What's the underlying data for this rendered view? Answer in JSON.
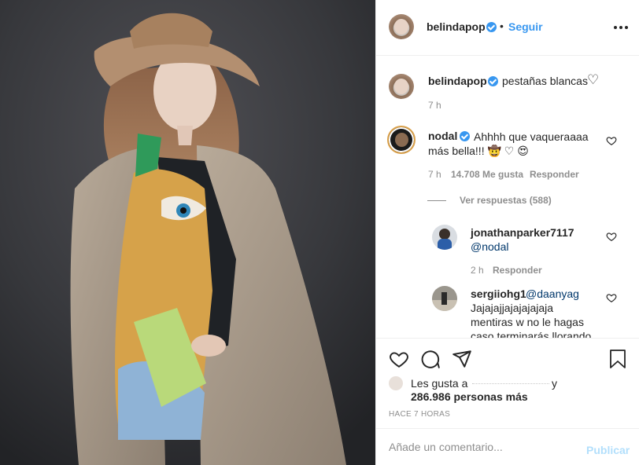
{
  "post": {
    "username": "belindapop",
    "follow_label": "Seguir",
    "dot": "•",
    "caption": "pestañas blancas",
    "caption_heart": "♡",
    "caption_time": "7 h"
  },
  "comments": [
    {
      "username": "nodal",
      "verified": true,
      "text": "Ahhhh que vaqueraaaa",
      "text_line2": "más bella!!! 🤠 ♡ 😍",
      "time": "7 h",
      "likes": "14.708 Me gusta",
      "reply_label": "Responder",
      "view_replies": "Ver respuestas (588)",
      "replies": [
        {
          "username": "jonathanparker7117",
          "mention": "@nodal",
          "text": "",
          "time": "2 h",
          "reply_label": "Responder"
        },
        {
          "username": "sergiiohg1",
          "mention": "@daanyag",
          "text": "Jajajajjajajajajaja",
          "text_line2": "mentiras w no le hagas",
          "text_line3": "caso terminarás llorando"
        }
      ]
    }
  ],
  "likes": {
    "prefix": "Les gusta a",
    "suffix": "y",
    "count_text": "286.986 personas más"
  },
  "time_ago": "HACE 7 HORAS",
  "comment_box": {
    "placeholder": "Añade un comentario...",
    "publish_label": "Publicar"
  },
  "colors": {
    "accent": "#3897f0",
    "publish_disabled": "#b2dffc",
    "secondary_text": "#8e8e8e"
  },
  "icons": [
    "heart-icon",
    "comment-icon",
    "share-icon",
    "save-icon",
    "more-options-icon",
    "verified-badge-icon"
  ]
}
